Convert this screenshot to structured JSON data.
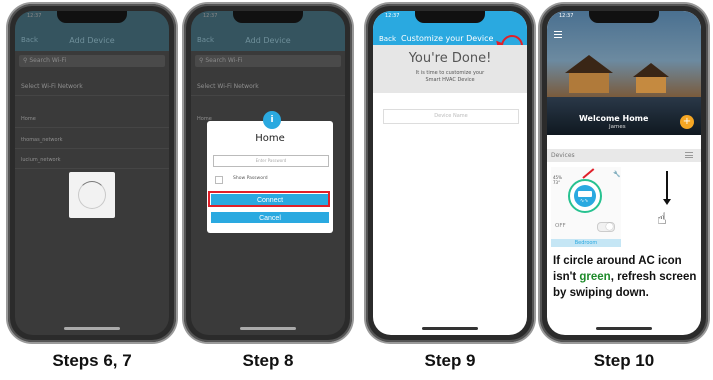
{
  "captions": [
    "Steps 6, 7",
    "Step 8",
    "Step 9",
    "Step 10"
  ],
  "status": {
    "time": "12:37"
  },
  "step67": {
    "back": "Back",
    "title": "Add Device",
    "search_placeholder": "Search Wi-Fi",
    "section": "Select Wi-Fi Network",
    "networks": [
      "Home",
      "thomas_network",
      "lucium_network"
    ]
  },
  "step8": {
    "back": "Back",
    "title": "Add Device",
    "search_placeholder": "Search Wi-Fi",
    "section": "Select Wi-Fi Network",
    "networks": [
      "Home",
      "",
      ""
    ],
    "info_glyph": "i",
    "dialog_title": "Home",
    "password_placeholder": "Enter Password",
    "show_password": "Show Password",
    "connect": "Connect",
    "cancel": "Cancel"
  },
  "step9": {
    "back": "Back",
    "title": "Customize your Device",
    "headline": "You're Done!",
    "sub1": "It is time to customize your",
    "sub2": "Smart HVAC Device",
    "device_name_placeholder": "Device Name"
  },
  "step10": {
    "welcome": "Welcome Home",
    "user": "James",
    "plus": "+",
    "devices_header": "Devices",
    "humidity": "45%",
    "temperature": "73°",
    "power": "OFF",
    "room": "Bedroom",
    "note_part1": "If circle around AC icon isn't ",
    "note_green": "green",
    "note_part2": ", refresh screen by swiping down."
  },
  "colors": {
    "accent": "#2aa9e0",
    "highlight": "#e0202a",
    "ok": "#27c290",
    "note_green": "#1e8a2a"
  }
}
